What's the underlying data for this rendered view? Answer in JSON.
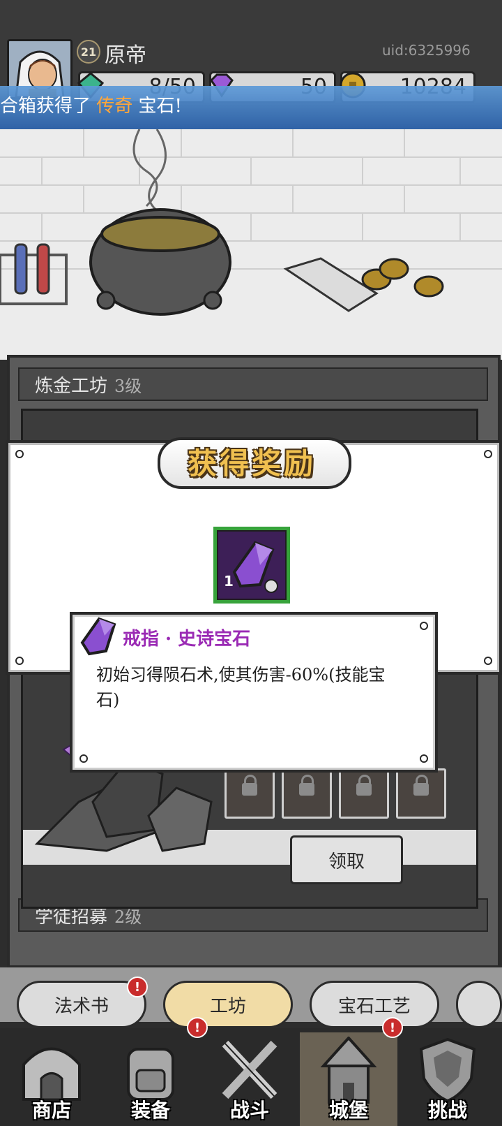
{
  "player": {
    "level": "21",
    "name": "原帝",
    "uid": "uid:6325996"
  },
  "resources": [
    {
      "icon": "green-gem-icon",
      "value": "8/50"
    },
    {
      "icon": "purple-gem-icon",
      "value": "50"
    },
    {
      "icon": "gold-coin-icon",
      "value": "10284"
    }
  ],
  "banner": {
    "prefix": "合箱获得了 ",
    "highlight": "传奇",
    "suffix": " 宝石!"
  },
  "workshop": {
    "section1": {
      "title": "炼金工坊",
      "level": "3级"
    },
    "section2": {
      "title": "学徒招募",
      "level": "2级"
    },
    "collect_label": "领取"
  },
  "tabs": [
    {
      "label": "法术书",
      "badge": "!"
    },
    {
      "label": "工坊",
      "active": true
    },
    {
      "label": "宝石工艺"
    }
  ],
  "nav": [
    {
      "label": "商店"
    },
    {
      "label": "装备",
      "badge": "!"
    },
    {
      "label": "战斗"
    },
    {
      "label": "城堡",
      "badge": "!",
      "active": true
    },
    {
      "label": "挑战"
    }
  ],
  "reward_dialog": {
    "title": "获得奖励",
    "item_count": "1",
    "tooltip_title": "戒指 · 史诗宝石",
    "tooltip_desc": "初始习得陨石术,使其伤害-60%(技能宝石)"
  },
  "colors": {
    "epic": "#9a2ab4",
    "legendary": "#ffa63a",
    "rare_border": "#37a33b"
  }
}
